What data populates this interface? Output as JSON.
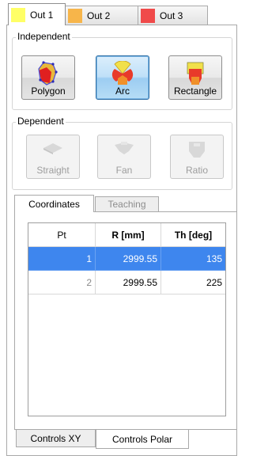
{
  "output_tabs": [
    {
      "label": "Out 1",
      "color": "#ffff66"
    },
    {
      "label": "Out 2",
      "color": "#f7b54a"
    },
    {
      "label": "Out 3",
      "color": "#f04a4a"
    }
  ],
  "independent": {
    "label": "Independent",
    "buttons": [
      {
        "label": "Polygon",
        "icon": "polygon-shape-icon"
      },
      {
        "label": "Arc",
        "icon": "arc-shape-icon",
        "pressed": true
      },
      {
        "label": "Rectangle",
        "icon": "rectangle-shape-icon"
      }
    ]
  },
  "dependent": {
    "label": "Dependent",
    "buttons": [
      {
        "label": "Straight",
        "icon": "straight-shape-icon"
      },
      {
        "label": "Fan",
        "icon": "fan-shape-icon"
      },
      {
        "label": "Ratio",
        "icon": "ratio-shape-icon"
      }
    ]
  },
  "view_tabs": {
    "coordinates": "Coordinates",
    "teaching": "Teaching"
  },
  "table": {
    "headers": [
      "Pt",
      "R [mm]",
      "Th [deg]"
    ],
    "rows": [
      {
        "pt": "1",
        "r": "2999.55",
        "th": "135",
        "selected": true
      },
      {
        "pt": "2",
        "r": "2999.55",
        "th": "225",
        "selected": false
      }
    ]
  },
  "control_tabs": {
    "xy": "Controls XY",
    "polar": "Controls Polar"
  }
}
